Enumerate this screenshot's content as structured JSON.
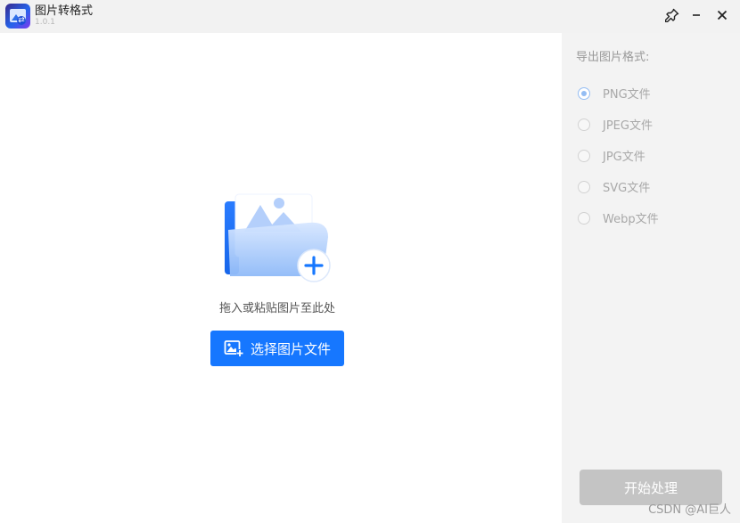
{
  "window": {
    "title": "图片转格式",
    "version": "1.0.1",
    "pin_glyph": "⚲",
    "minimize_glyph": "−",
    "close_glyph": "✕"
  },
  "main": {
    "drop_hint": "拖入或粘贴图片至此处",
    "select_button_label": "选择图片文件"
  },
  "sidebar": {
    "title": "导出图片格式:",
    "formats": [
      {
        "label": "PNG文件",
        "checked": true
      },
      {
        "label": "JPEG文件",
        "checked": false
      },
      {
        "label": "JPG文件",
        "checked": false
      },
      {
        "label": "SVG文件",
        "checked": false
      },
      {
        "label": "Webp文件",
        "checked": false
      }
    ],
    "start_button_label": "开始处理"
  },
  "watermark": "CSDN @AI巨人",
  "colors": {
    "accent": "#1677ff",
    "radio_checked": "#94bdf3",
    "disabled_button": "#c4c4c4"
  },
  "icons": [
    "app-icon",
    "pin-icon",
    "minimize-icon",
    "close-icon",
    "upload-folder-icon",
    "add-image-icon"
  ]
}
